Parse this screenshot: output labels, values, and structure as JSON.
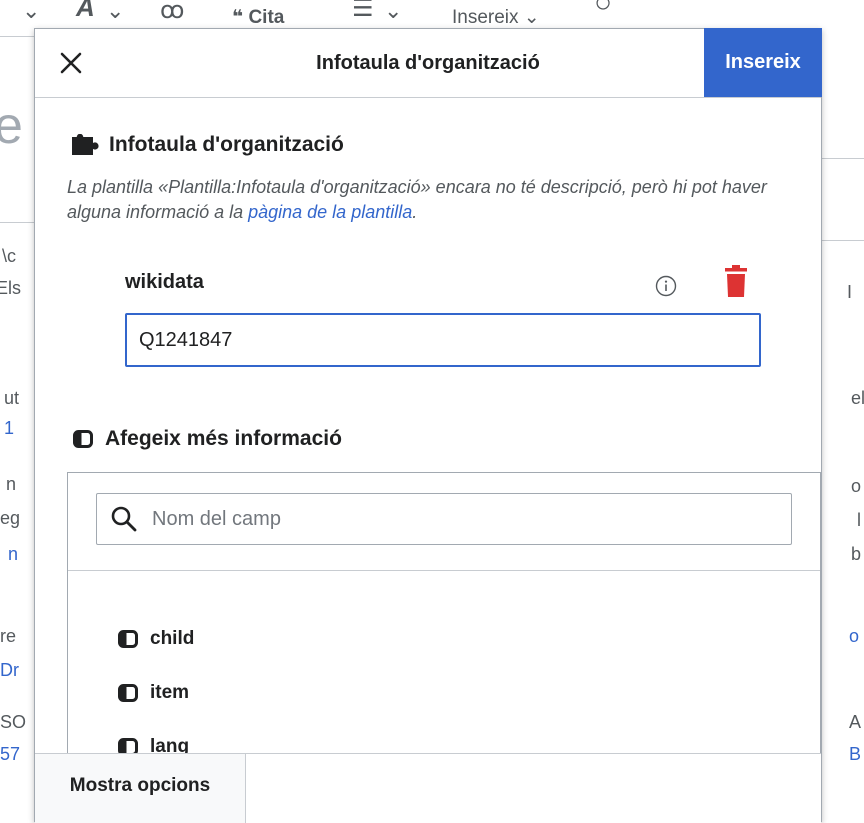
{
  "background": {
    "toolbar": {
      "cite_label": "Cita",
      "insert_label": "Insereix"
    },
    "page_fragments": [
      "e",
      "\\c",
      "Els",
      "ut",
      "1",
      "n",
      "eg",
      "n",
      "re",
      "Dr",
      "SO",
      "57"
    ],
    "right_fragments": [
      "I",
      "el",
      "o",
      "l",
      "b",
      "o",
      "A",
      "B"
    ]
  },
  "dialog": {
    "title": "Infotaula d'organització",
    "insert_label": "Insereix",
    "template": {
      "heading": "Infotaula d'organització",
      "description_text": "La plantilla «Plantilla:Infotaula d'organització» encara no té descripció, però hi pot haver alguna informació a la ",
      "description_link": "pàgina de la plantilla",
      "description_end": "."
    },
    "parameter": {
      "label": "wikidata",
      "value": "Q1241847"
    },
    "add_more": {
      "heading": "Afegeix més informació",
      "search_placeholder": "Nom del camp",
      "fields": [
        {
          "label": "child"
        },
        {
          "label": "item"
        },
        {
          "label": "lang"
        }
      ]
    },
    "footer": {
      "more_options_label": "Mostra opcions"
    }
  },
  "colors": {
    "accent": "#3366cc",
    "delete": "#d33"
  }
}
